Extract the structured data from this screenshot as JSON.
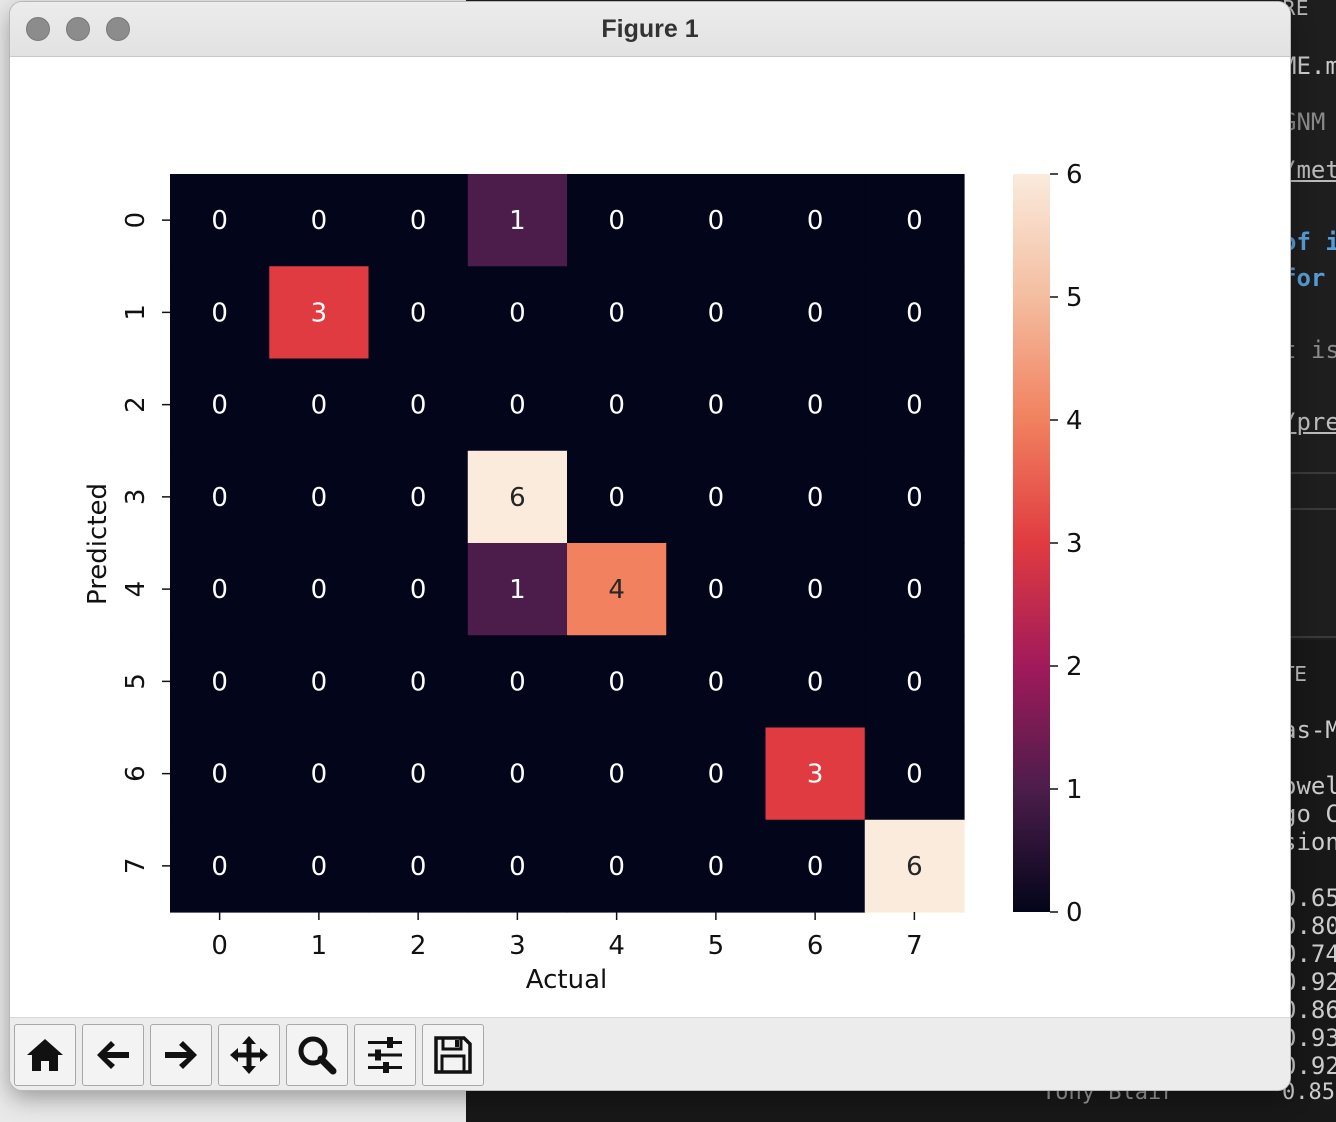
{
  "window": {
    "title": "Figure 1"
  },
  "chart_data": {
    "type": "heatmap",
    "title": "",
    "xlabel": "Actual",
    "ylabel": "Predicted",
    "x_ticks": [
      "0",
      "1",
      "2",
      "3",
      "4",
      "5",
      "6",
      "7"
    ],
    "y_ticks": [
      "0",
      "1",
      "2",
      "3",
      "4",
      "5",
      "6",
      "7"
    ],
    "values": [
      [
        0,
        0,
        0,
        1,
        0,
        0,
        0,
        0
      ],
      [
        0,
        3,
        0,
        0,
        0,
        0,
        0,
        0
      ],
      [
        0,
        0,
        0,
        0,
        0,
        0,
        0,
        0
      ],
      [
        0,
        0,
        0,
        6,
        0,
        0,
        0,
        0
      ],
      [
        0,
        0,
        0,
        1,
        4,
        0,
        0,
        0
      ],
      [
        0,
        0,
        0,
        0,
        0,
        0,
        0,
        0
      ],
      [
        0,
        0,
        0,
        0,
        0,
        0,
        3,
        0
      ],
      [
        0,
        0,
        0,
        0,
        0,
        0,
        0,
        6
      ]
    ],
    "annotated": true,
    "colormap": "rocket",
    "colorbar": {
      "min": 0,
      "max": 6,
      "ticks": [
        "0",
        "1",
        "2",
        "3",
        "4",
        "5",
        "6"
      ]
    }
  },
  "toolbar": {
    "buttons": [
      "home-icon",
      "back-arrow-icon",
      "forward-arrow-icon",
      "pan-icon",
      "zoom-icon",
      "configure-subplots-icon",
      "save-icon"
    ]
  },
  "background": {
    "lines": [
      "RE",
      "ME.m",
      "GNM",
      "/met",
      "of i",
      "for",
      "t is",
      "/pre",
      "TE",
      "as-M",
      "owel",
      "go C",
      "sion",
      "0.65",
      "0.80",
      "0.74",
      "0.92",
      "0.86",
      "0.93",
      "0.92"
    ],
    "bottom_name": "Tony Blair",
    "bottom_score": "0.85"
  }
}
